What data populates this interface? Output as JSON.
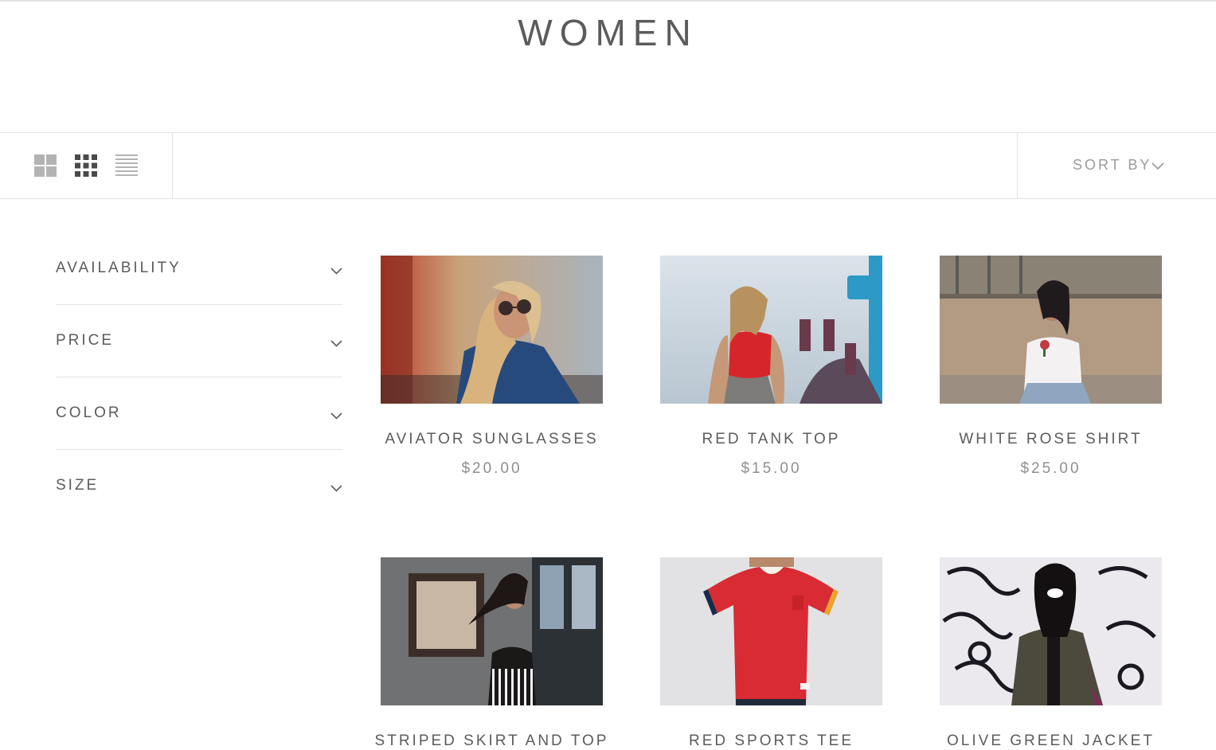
{
  "header": {
    "title": "WOMEN"
  },
  "toolbar": {
    "layout_options": [
      {
        "icon": "grid-2x2-icon",
        "active": false
      },
      {
        "icon": "grid-3x3-icon",
        "active": true
      },
      {
        "icon": "list-view-icon",
        "active": false
      }
    ],
    "sort_label": "SORT BY",
    "sort_icon": "chevron-down-icon"
  },
  "filters": [
    {
      "label": "AVAILABILITY"
    },
    {
      "label": "PRICE"
    },
    {
      "label": "COLOR"
    },
    {
      "label": "SIZE"
    }
  ],
  "products": [
    {
      "name": "AVIATOR SUNGLASSES",
      "price": "$20.00",
      "image": "woman-in-sunglasses-and-denim-jacket"
    },
    {
      "name": "RED TANK TOP",
      "price": "$15.00",
      "image": "woman-in-red-crop-top-at-fair"
    },
    {
      "name": "WHITE ROSE SHIRT",
      "price": "$25.00",
      "image": "woman-in-white-shirt-with-rose"
    },
    {
      "name": "STRIPED SKIRT AND TOP",
      "price": "",
      "image": "woman-in-black-top-striped-skirt"
    },
    {
      "name": "RED SPORTS TEE",
      "price": "",
      "image": "red-ringer-tee"
    },
    {
      "name": "OLIVE GREEN JACKET",
      "price": "",
      "image": "woman-in-olive-jacket-graffiti-wall"
    }
  ],
  "colors": {
    "text": "#5c5c5c",
    "muted": "#9a9a9a",
    "border": "#e3e3e3",
    "icon_active": "#4a4a4a",
    "icon_inactive": "#b3b3b3"
  }
}
